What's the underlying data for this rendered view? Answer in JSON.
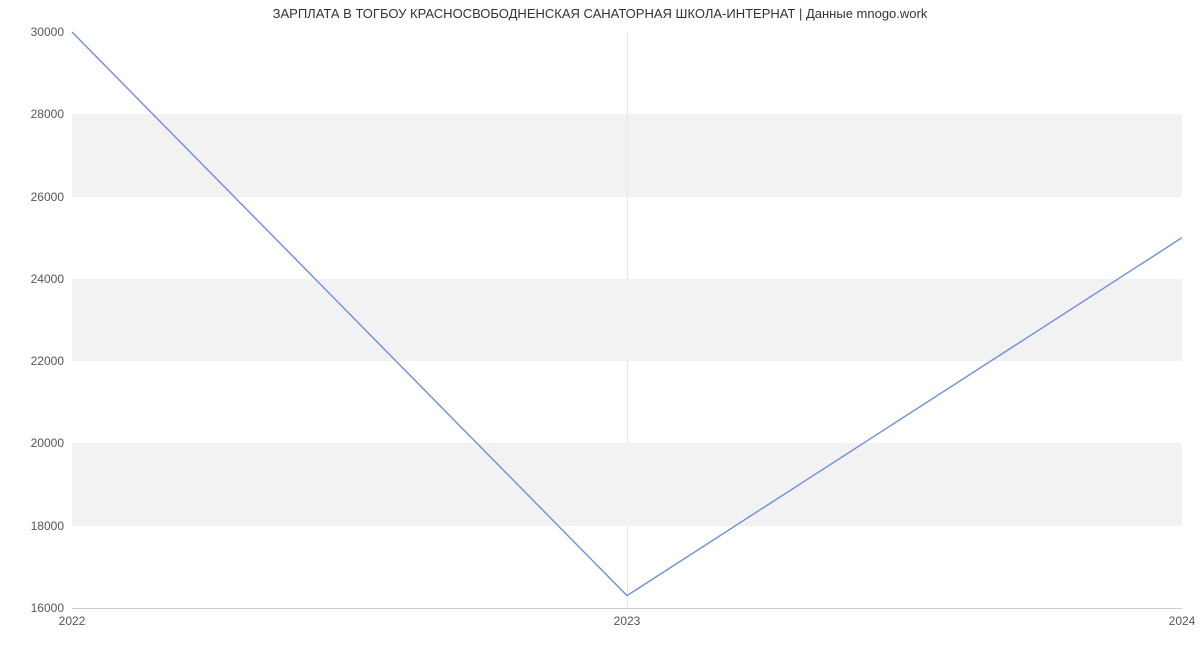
{
  "chart_data": {
    "type": "line",
    "title": "ЗАРПЛАТА В ТОГБОУ КРАСНОСВОБОДНЕНСКАЯ САНАТОРНАЯ ШКОЛА-ИНТЕРНАТ | Данные mnogo.work",
    "x": [
      2022,
      2023,
      2024
    ],
    "values": [
      30000,
      16300,
      25000
    ],
    "xlabel": "",
    "ylabel": "",
    "xticks": [
      2022,
      2023,
      2024
    ],
    "yticks": [
      16000,
      18000,
      20000,
      22000,
      24000,
      26000,
      28000,
      30000
    ],
    "xlim": [
      2022,
      2024
    ],
    "ylim": [
      16000,
      30000
    ],
    "line_color": "#6f8fdc"
  }
}
